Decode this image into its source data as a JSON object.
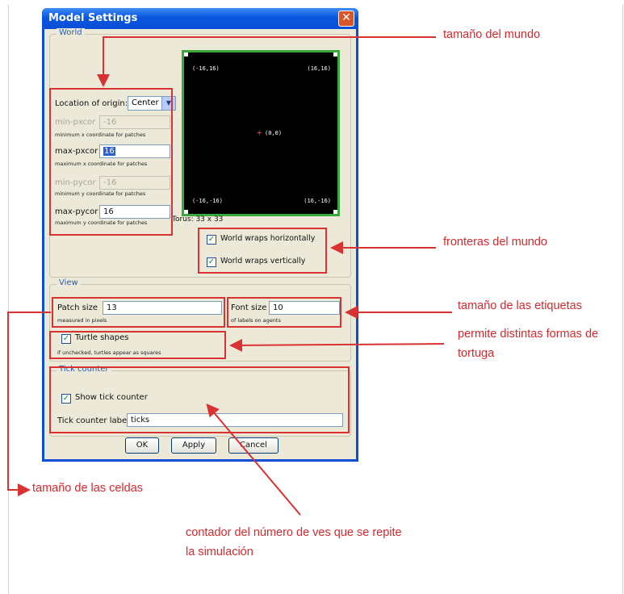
{
  "dialog": {
    "title": "Model Settings",
    "close_glyph": "✕",
    "world": {
      "group_title": "World",
      "location_of_origin_label": "Location of origin:",
      "location_of_origin_value": "Center",
      "min_pxcor_label": "min-pxcor",
      "min_pxcor_value": "-16",
      "min_pxcor_hint": "minimum x coordinate for patches",
      "max_pxcor_label": "max-pxcor",
      "max_pxcor_value": "16",
      "max_pxcor_hint": "maximum x coordinate for patches",
      "min_pycor_label": "min-pycor",
      "min_pycor_value": "-16",
      "min_pycor_hint": "minimum y coordinate for patches",
      "max_pycor_label": "max-pycor",
      "max_pycor_value": "16",
      "max_pycor_hint": "maximum y coordinate for patches",
      "preview": {
        "top_left": "(-16,16)",
        "top_right": "(16,16)",
        "center": "(0,0)",
        "bottom_left": "(-16,-16)",
        "bottom_right": "(16,-16)",
        "topology_caption": "Torus: 33 x 33"
      },
      "wrap_horizontal_label": "World wraps horizontally",
      "wrap_horizontal_checked": true,
      "wrap_vertical_label": "World wraps vertically",
      "wrap_vertical_checked": true
    },
    "view": {
      "group_title": "View",
      "patch_size_label": "Patch size",
      "patch_size_value": "13",
      "patch_size_hint": "measured in pixels",
      "font_size_label": "Font size",
      "font_size_value": "10",
      "font_size_hint": "of labels on agents",
      "turtle_shapes_label": "Turtle shapes",
      "turtle_shapes_checked": true,
      "turtle_shapes_hint": "if unchecked, turtles appear as squares"
    },
    "tick_counter": {
      "group_title": "Tick counter",
      "show_label": "Show tick counter",
      "show_checked": true,
      "label_label": "Tick counter label",
      "label_value": "ticks"
    },
    "buttons": {
      "ok": "OK",
      "apply": "Apply",
      "cancel": "Cancel"
    }
  },
  "annotations": {
    "world_size": "tamaño del mundo",
    "world_borders": "fronteras del mundo",
    "label_size": "tamaño de las etiquetas",
    "turtle_shapes_line1": "permite distintas formas de",
    "turtle_shapes_line2": "tortuga",
    "cell_size": "tamaño de las celdas",
    "tick_counter_line1": "contador del número de ves que se repite",
    "tick_counter_line2": "la simulación"
  },
  "colors": {
    "annotation_red": "#d83232",
    "titlebar_blue": "#0a4fd6",
    "dialog_bg": "#ece9d8"
  }
}
